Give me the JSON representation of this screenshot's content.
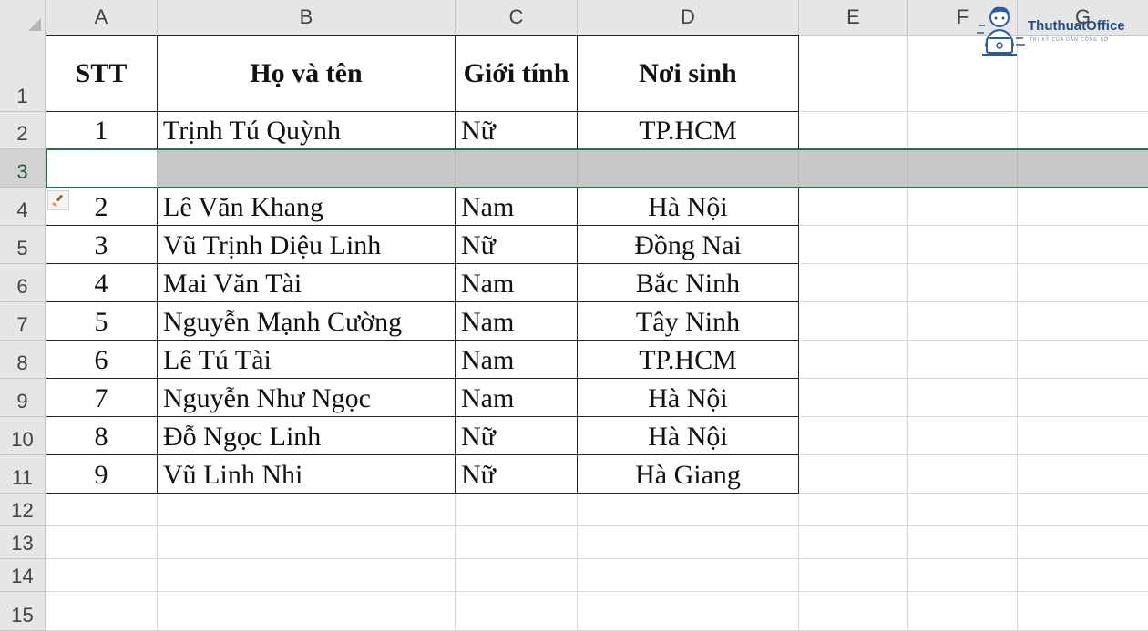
{
  "columns": [
    "A",
    "B",
    "C",
    "D",
    "E",
    "F",
    "G"
  ],
  "rows": [
    "1",
    "2",
    "3",
    "4",
    "5",
    "6",
    "7",
    "8",
    "9",
    "10",
    "11",
    "12",
    "13",
    "14",
    "15"
  ],
  "header": {
    "stt": "STT",
    "name": "Họ và tên",
    "gender": "Giới tính",
    "birthplace": "Nơi sinh"
  },
  "data_rows": [
    {
      "stt": "1",
      "name": "Trịnh Tú Quỳnh",
      "gender": "Nữ",
      "birthplace": "TP.HCM"
    },
    {
      "stt": "",
      "name": "",
      "gender": "",
      "birthplace": ""
    },
    {
      "stt": "2",
      "name": "Lê Văn Khang",
      "gender": "Nam",
      "birthplace": "Hà Nội"
    },
    {
      "stt": "3",
      "name": "Vũ Trịnh Diệu Linh",
      "gender": "Nữ",
      "birthplace": "Đồng Nai"
    },
    {
      "stt": "4",
      "name": "Mai Văn Tài",
      "gender": "Nam",
      "birthplace": "Bắc Ninh"
    },
    {
      "stt": "5",
      "name": "Nguyễn Mạnh Cường",
      "gender": "Nam",
      "birthplace": "Tây Ninh"
    },
    {
      "stt": "6",
      "name": "Lê Tú Tài",
      "gender": "Nam",
      "birthplace": "TP.HCM"
    },
    {
      "stt": "7",
      "name": "Nguyễn Như Ngọc",
      "gender": "Nam",
      "birthplace": "Hà Nội"
    },
    {
      "stt": "8",
      "name": "Đỗ Ngọc Linh",
      "gender": "Nữ",
      "birthplace": "Hà Nội"
    },
    {
      "stt": "9",
      "name": "Vũ Linh Nhi",
      "gender": "Nữ",
      "birthplace": "Hà Giang"
    }
  ],
  "logo": {
    "name": "ThuthuatOffice",
    "tagline": "TRI KỶ CỦA DÂN CÔNG SỞ"
  },
  "colors": {
    "selection": "#217346",
    "selected_row_fill": "#c8c8c8",
    "header_fill": "#e6e6e6"
  },
  "selected_row": "3"
}
